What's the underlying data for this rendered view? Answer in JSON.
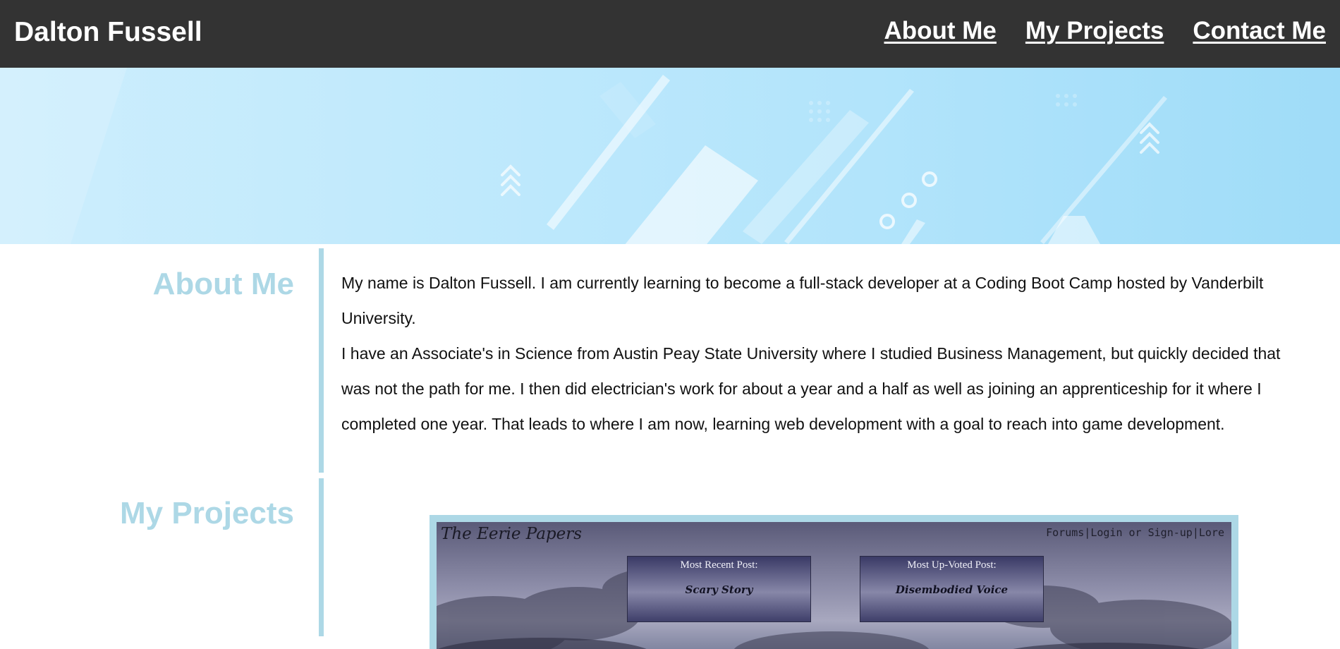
{
  "header": {
    "site_title": "Dalton Fussell",
    "nav": [
      "About Me",
      "My Projects",
      "Contact Me"
    ]
  },
  "about": {
    "title": "About Me",
    "paragraph_1": "My name is Dalton Fussell. I am currently learning to become a full-stack developer at a Coding Boot Camp hosted by Vanderbilt University.",
    "paragraph_2": "I have an Associate's in Science from Austin Peay State University where I studied Business Management, but quickly decided that was not the path for me. I then did electrician's work for about a year and a half as well as joining an apprenticeship for it where I completed one year. That leads to where I am now, learning web development with a goal to reach into game development."
  },
  "projects": {
    "title": "My Projects",
    "items": [
      {
        "site_title": "The Eerie Papers",
        "nav_text": "Forums|Login or Sign-up|Lore",
        "cards": [
          {
            "heading": "Most Recent Post:",
            "body": "Scary Story"
          },
          {
            "heading": "Most Up-Voted Post:",
            "body": "Disembodied Voice"
          }
        ]
      }
    ]
  },
  "colors": {
    "header_bg": "#333333",
    "accent": "#add8e6",
    "hero_light": "#cdeefd",
    "hero_dark": "#9fdcf8"
  }
}
